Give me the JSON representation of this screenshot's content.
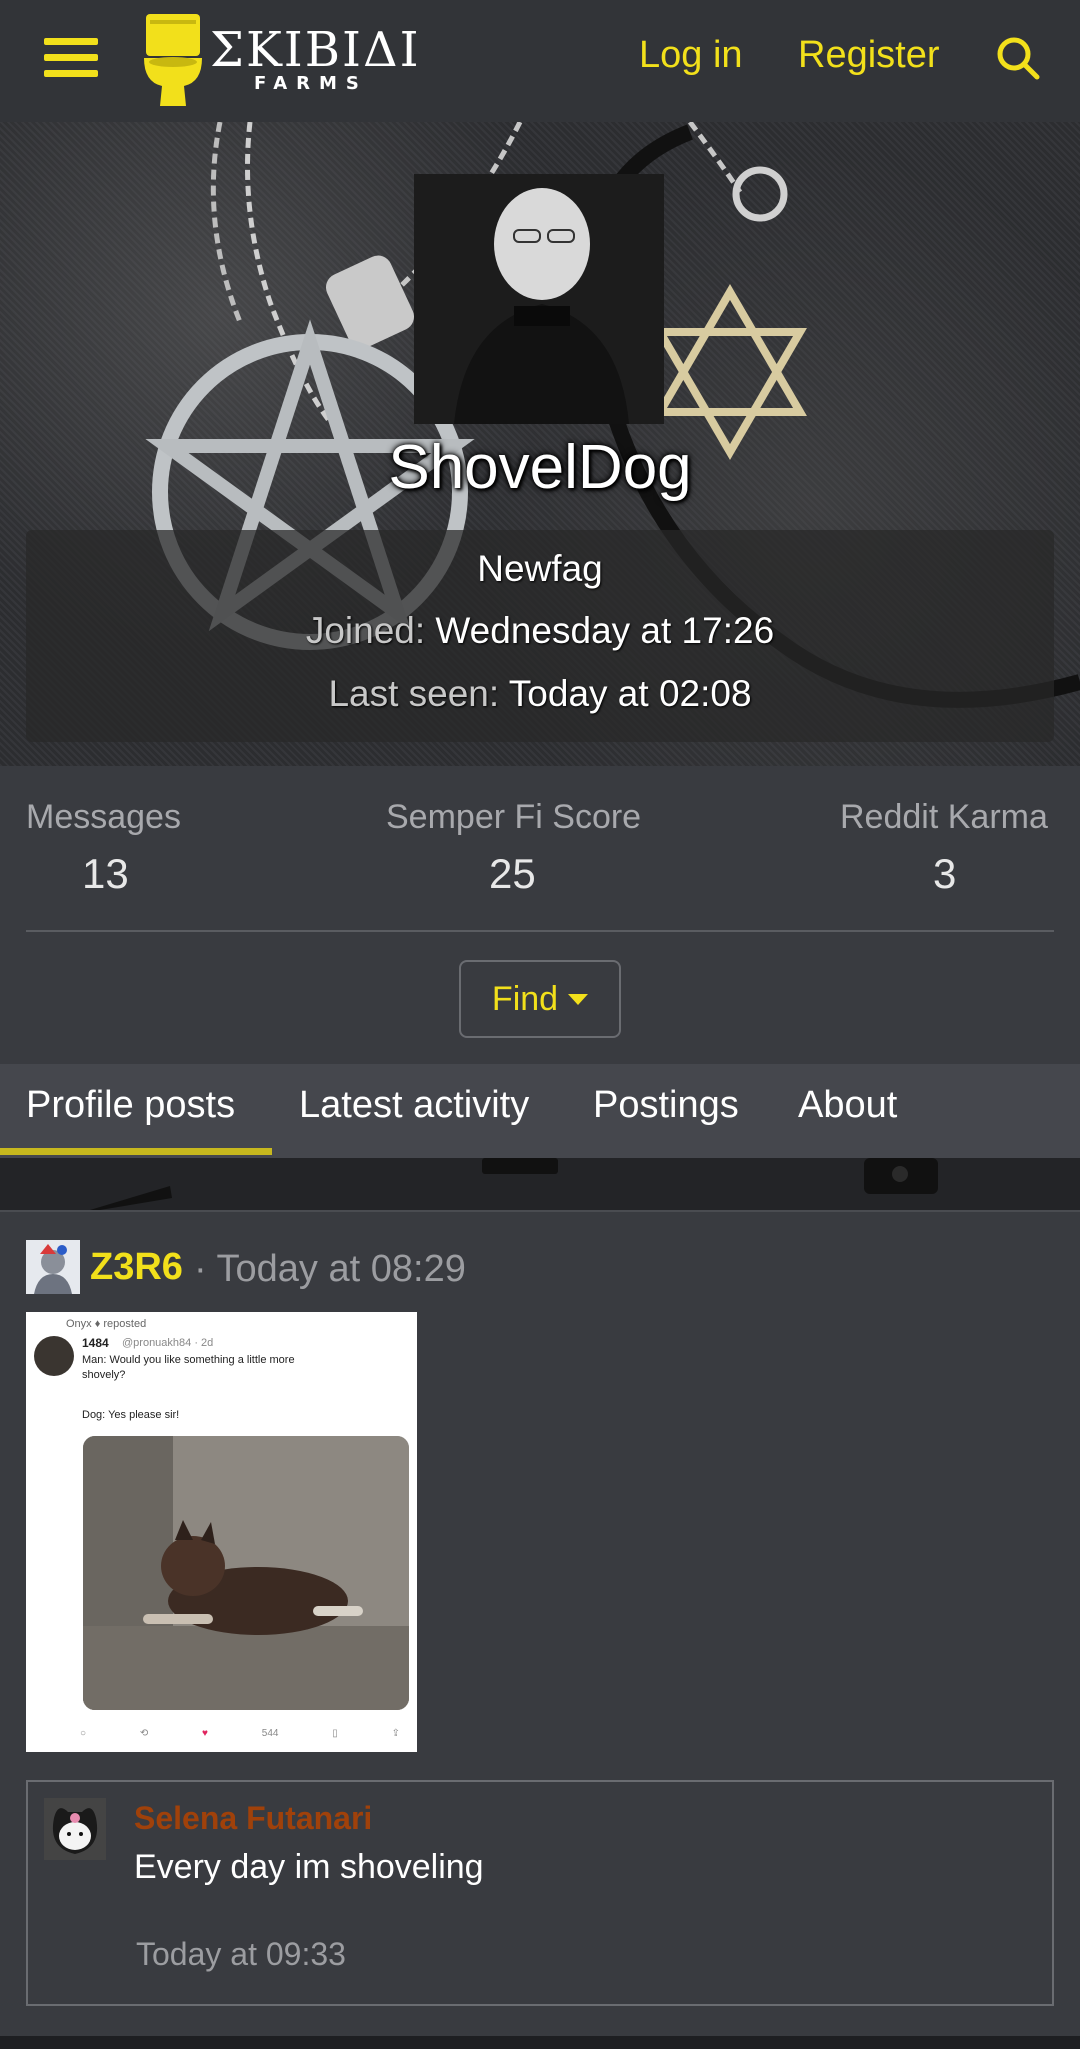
{
  "header": {
    "logo_main": "ΣKIBIΔI",
    "logo_sub": "FARMS",
    "login_label": "Log in",
    "register_label": "Register",
    "accent_color": "#f2e01b"
  },
  "profile": {
    "username": "ShovelDog",
    "user_title": "Newfag",
    "joined_label": "Joined:",
    "joined_value": "Wednesday at 17:26",
    "last_seen_label": "Last seen:",
    "last_seen_value": "Today at 02:08"
  },
  "stats": [
    {
      "label": "Messages",
      "value": "13"
    },
    {
      "label": "Semper Fi Score",
      "value": "25"
    },
    {
      "label": "Reddit Karma",
      "value": "3"
    }
  ],
  "find_label": "Find",
  "tabs": [
    {
      "label": "Profile posts",
      "active": true
    },
    {
      "label": "Latest activity",
      "active": false
    },
    {
      "label": "Postings",
      "active": false
    },
    {
      "label": "About",
      "active": false
    }
  ],
  "post": {
    "author": "Z3R6",
    "separator": "·",
    "time": "Today at 08:29",
    "image_text": {
      "repost": "Onyx ♦ reposted",
      "name": "1484",
      "handle": "@pronuakh84 · 2d",
      "line1": "Man: Would you like something a little more",
      "line2": "shovely?",
      "line3": "Dog: Yes please sir!",
      "views": "544"
    },
    "comment": {
      "author": "Selena Futanari",
      "text": "Every day im shoveling",
      "time": "Today at 09:33"
    }
  }
}
